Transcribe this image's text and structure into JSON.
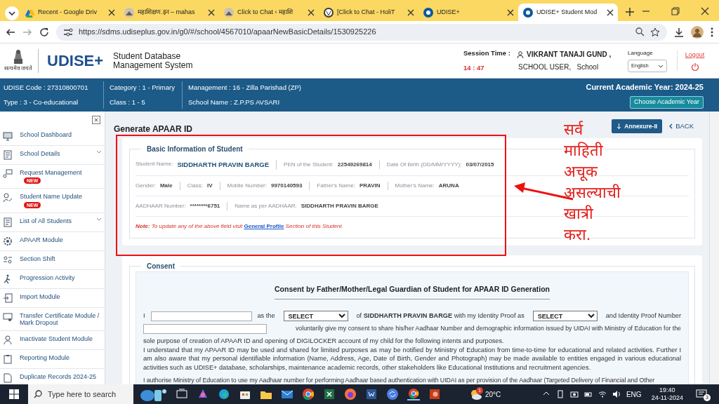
{
  "browser": {
    "tabs": [
      {
        "title": "Recent - Google Driv",
        "selected": false
      },
      {
        "title": "महाशिक्षण.इन – mahas",
        "selected": false
      },
      {
        "title": "Click to Chat ‹ महाशि",
        "selected": false
      },
      {
        "title": "[Click to Chat - HoliT",
        "selected": false
      },
      {
        "title": "UDISE+",
        "selected": false
      },
      {
        "title": "UDISE+ Student Mod",
        "selected": true
      }
    ],
    "url": "https://sdms.udiseplus.gov.in/g0/#/school/4567010/apaarNewBasicDetails/1530925226"
  },
  "header": {
    "emblem_caption": "सत्यमेव जयते",
    "logo": "UDISE+",
    "system_name": [
      "Student Database",
      "Management System"
    ],
    "session_label": "Session Time :",
    "session_time": "14 : 47",
    "user_name": "VIKRANT TANAJI GUND ,",
    "user_role": "SCHOOL USER,   School",
    "language_label": "Language",
    "language": "English",
    "logout": "Logout"
  },
  "school_bar": {
    "groups": [
      [
        "UDISE Code : 27310800701",
        "Type : 3 - Co-educational"
      ],
      [
        "Category : 1 - Primary",
        "Class : 1 - 5"
      ],
      [
        "Management : 16 - Zilla Parishad (ZP)",
        "School Name : Z.P.PS AVSARI"
      ]
    ],
    "academic_year": "Current Academic Year: 2024-25",
    "choose_button": "Choose Academic Year"
  },
  "sidebar": {
    "items": [
      {
        "label": "School Dashboard",
        "expandable": false
      },
      {
        "label": "School Details",
        "expandable": true
      },
      {
        "label": "Request Management",
        "expandable": false,
        "badge": "NEW"
      },
      {
        "label": "Student Name Update",
        "expandable": false,
        "badge": "NEW"
      },
      {
        "label": "List of All Students",
        "expandable": true
      },
      {
        "label": "APAAR Module",
        "expandable": false
      },
      {
        "label": "Section Shift",
        "expandable": false
      },
      {
        "label": "Progression Activity",
        "expandable": false
      },
      {
        "label": "Import Module",
        "expandable": false
      },
      {
        "label": "Transfer Certificate Module / Mark Dropout",
        "expandable": false
      },
      {
        "label": "Inactivate Student Module",
        "expandable": false
      },
      {
        "label": "Reporting Module",
        "expandable": false
      },
      {
        "label": "Duplicate Records 2024-25",
        "expandable": false
      }
    ]
  },
  "page": {
    "title": "Generate APAAR ID",
    "annexure_button": "Annexure-II",
    "back_link": "BACK"
  },
  "basic_info": {
    "legend": "Basic Information of Student",
    "lines": [
      {
        "fields": [
          {
            "label": "Student Name:",
            "value": "SIDDHARTH PRAVIN BARGE",
            "kind": "name"
          },
          {
            "label": "PEN of the Student:",
            "value": "22549269814",
            "kind": "plain"
          },
          {
            "label": "Date Of Birth (DD/MM/YYYY):",
            "value": "03/07/2015",
            "kind": "plain"
          }
        ]
      },
      {
        "fields": [
          {
            "label": "Gender:",
            "value": "Male",
            "kind": "plain"
          },
          {
            "label": "Class:",
            "value": "IV",
            "kind": "plain"
          },
          {
            "label": "Mobile Number:",
            "value": "9970140593",
            "kind": "plain"
          },
          {
            "label": "Father's Name:",
            "value": "PRAVIN",
            "kind": "plain"
          },
          {
            "label": "Mother's Name:",
            "value": "ARUNA",
            "kind": "plain"
          }
        ]
      },
      {
        "fields": [
          {
            "label": "AADHAAR Number:",
            "value": "********6751",
            "kind": "plain"
          },
          {
            "label": "Name as per AADHAAR:",
            "value": "SIDDHARTH PRAVIN BARGE",
            "kind": "plain"
          }
        ]
      }
    ],
    "note": {
      "label": "Note:",
      "before": "To update any of the above field visit",
      "link": "General Profile",
      "after": "Section of this Student"
    }
  },
  "consent": {
    "legend": "Consent",
    "heading": "Consent by Father/Mother/Legal Guardian of Student for APAAR ID Generation",
    "prefix": "I",
    "relation_text": "as the",
    "relation_select": "SELECT",
    "of_text": "of",
    "student_name": "SIDDHARTH PRAVIN BARGE",
    "proof_text": "with my Identity Proof as",
    "proof_select": "SELECT",
    "number_text": "and Identity Proof Number",
    "consent_text": "voluntarily give my consent to share his/her Aadhaar Number and demographic information issued by UIDAI with Ministry of Education for the",
    "consent_text_2": "sole purpose of creation of APAAR ID and opening of DIGILOCKER account of my child for the following intents and purposes.",
    "paragraphs": [
      "I understand that my APAAR ID may be used and shared for limited purposes as may be notified by Ministry of Education from time-to-time for educational and related activities. Further I am also aware that my personal identifiable information (Name, Address, Age, Date of Birth, Gender and Photograph) may be made available to entities engaged in various educational activities such as UDISE+ database, scholarships, maintenance academic records, other stakeholders like Educational Institutions and recruitment agencies.",
      "I authorise Ministry of Education to use my Aadhaar number for performing Aadhaar based authentication with UIDAI as per provision of the Aadhaar (Targeted Delivery of Financial and Other"
    ]
  },
  "annotation": {
    "lines": [
      "सर्व",
      "माहिती",
      "अचूक",
      "असल्याची",
      "खात्री",
      "करा."
    ]
  },
  "taskbar": {
    "search_placeholder": "Type here to search",
    "weather_badge": "1",
    "temperature": "20°C",
    "language": "ENG",
    "time": "19:40",
    "date": "24-11-2024",
    "notifications": "3"
  }
}
